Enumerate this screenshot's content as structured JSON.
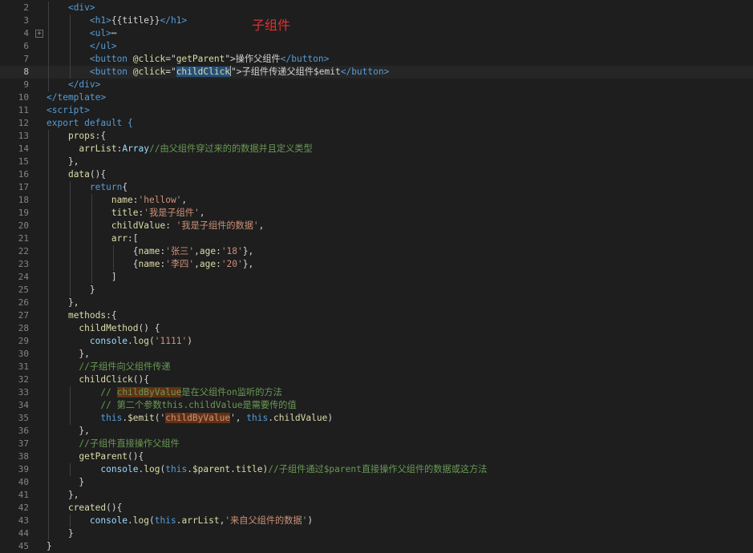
{
  "annotation": "子组件",
  "lines": [
    {
      "n": "2",
      "indent": 1,
      "segs": [
        {
          "t": "<div>",
          "c": "tag"
        }
      ]
    },
    {
      "n": "3",
      "indent": 2,
      "segs": [
        {
          "t": "<h1>",
          "c": "tag"
        },
        {
          "t": "{{title}}",
          "c": "plain"
        },
        {
          "t": "</h1>",
          "c": "tag"
        }
      ]
    },
    {
      "n": "4",
      "indent": 2,
      "fold": "+",
      "segs": [
        {
          "t": "<ul>",
          "c": "tag"
        },
        {
          "t": "⋯",
          "c": "plain"
        }
      ]
    },
    {
      "n": "6",
      "indent": 2,
      "segs": [
        {
          "t": "</ul>",
          "c": "tag"
        }
      ]
    },
    {
      "n": "7",
      "indent": 2,
      "segs": [
        {
          "t": "<button ",
          "c": "tag"
        },
        {
          "t": "@click",
          "c": "fn"
        },
        {
          "t": "=\"",
          "c": "plain"
        },
        {
          "t": "getParent",
          "c": "fn"
        },
        {
          "t": "\">",
          "c": "plain"
        },
        {
          "t": "操作父组件",
          "c": "plain"
        },
        {
          "t": "</button>",
          "c": "tag"
        }
      ]
    },
    {
      "n": "8",
      "indent": 2,
      "active": true,
      "segs": [
        {
          "t": "<button ",
          "c": "tag"
        },
        {
          "t": "@click",
          "c": "fn"
        },
        {
          "t": "=\"",
          "c": "plain"
        },
        {
          "t": "childClick",
          "c": "fn hl"
        },
        {
          "t": "",
          "c": "caret"
        },
        {
          "t": "\">",
          "c": "plain"
        },
        {
          "t": "子组件传递父组件$emit",
          "c": "plain"
        },
        {
          "t": "</button>",
          "c": "tag"
        }
      ]
    },
    {
      "n": "9",
      "indent": 1,
      "segs": [
        {
          "t": "</div>",
          "c": "tag"
        }
      ]
    },
    {
      "n": "10",
      "indent": 0,
      "segs": [
        {
          "t": "</template>",
          "c": "tag"
        }
      ]
    },
    {
      "n": "11",
      "indent": 0,
      "segs": [
        {
          "t": "<script>",
          "c": "tag"
        }
      ]
    },
    {
      "n": "12",
      "indent": 0,
      "segs": [
        {
          "t": "export default {",
          "c": "kw"
        }
      ]
    },
    {
      "n": "13",
      "indent": 1,
      "segs": [
        {
          "t": "props",
          "c": "fn"
        },
        {
          "t": ":{",
          "c": "plain"
        }
      ]
    },
    {
      "n": "14",
      "indent": 1,
      "extra": "  ",
      "segs": [
        {
          "t": "arrList",
          "c": "fn"
        },
        {
          "t": ":",
          "c": "plain"
        },
        {
          "t": "Array",
          "c": "prop"
        },
        {
          "t": "//由父组件穿过来的的数据并且定义类型",
          "c": "cm"
        }
      ]
    },
    {
      "n": "15",
      "indent": 1,
      "segs": [
        {
          "t": "},",
          "c": "plain"
        }
      ]
    },
    {
      "n": "16",
      "indent": 1,
      "segs": [
        {
          "t": "data",
          "c": "fn"
        },
        {
          "t": "(){",
          "c": "plain"
        }
      ]
    },
    {
      "n": "17",
      "indent": 2,
      "segs": [
        {
          "t": "return",
          "c": "kw"
        },
        {
          "t": "{",
          "c": "plain"
        }
      ]
    },
    {
      "n": "18",
      "indent": 3,
      "segs": [
        {
          "t": "name",
          "c": "fn"
        },
        {
          "t": ":",
          "c": "plain"
        },
        {
          "t": "'hellow'",
          "c": "str"
        },
        {
          "t": ",",
          "c": "plain"
        }
      ]
    },
    {
      "n": "19",
      "indent": 3,
      "segs": [
        {
          "t": "title",
          "c": "fn"
        },
        {
          "t": ":",
          "c": "plain"
        },
        {
          "t": "'我是子组件'",
          "c": "str"
        },
        {
          "t": ",",
          "c": "plain"
        }
      ]
    },
    {
      "n": "20",
      "indent": 3,
      "segs": [
        {
          "t": "childValue",
          "c": "fn"
        },
        {
          "t": ": ",
          "c": "plain"
        },
        {
          "t": "'我是子组件的数据'",
          "c": "str"
        },
        {
          "t": ",",
          "c": "plain"
        }
      ]
    },
    {
      "n": "21",
      "indent": 3,
      "segs": [
        {
          "t": "arr",
          "c": "fn"
        },
        {
          "t": ":[",
          "c": "plain"
        }
      ]
    },
    {
      "n": "22",
      "indent": 4,
      "segs": [
        {
          "t": "{",
          "c": "plain"
        },
        {
          "t": "name",
          "c": "fn"
        },
        {
          "t": ":",
          "c": "plain"
        },
        {
          "t": "'张三'",
          "c": "str"
        },
        {
          "t": ",",
          "c": "plain"
        },
        {
          "t": "age",
          "c": "fn"
        },
        {
          "t": ":",
          "c": "plain"
        },
        {
          "t": "'18'",
          "c": "str"
        },
        {
          "t": "},",
          "c": "plain"
        }
      ]
    },
    {
      "n": "23",
      "indent": 4,
      "segs": [
        {
          "t": "{",
          "c": "plain"
        },
        {
          "t": "name",
          "c": "fn"
        },
        {
          "t": ":",
          "c": "plain"
        },
        {
          "t": "'李四'",
          "c": "str"
        },
        {
          "t": ",",
          "c": "plain"
        },
        {
          "t": "age",
          "c": "fn"
        },
        {
          "t": ":",
          "c": "plain"
        },
        {
          "t": "'20'",
          "c": "str"
        },
        {
          "t": "},",
          "c": "plain"
        }
      ]
    },
    {
      "n": "24",
      "indent": 3,
      "segs": [
        {
          "t": "]",
          "c": "plain"
        }
      ]
    },
    {
      "n": "25",
      "indent": 2,
      "segs": [
        {
          "t": "}",
          "c": "plain"
        }
      ]
    },
    {
      "n": "26",
      "indent": 1,
      "segs": [
        {
          "t": "},",
          "c": "plain"
        }
      ]
    },
    {
      "n": "27",
      "indent": 1,
      "segs": [
        {
          "t": "methods",
          "c": "fn"
        },
        {
          "t": ":{",
          "c": "plain"
        }
      ]
    },
    {
      "n": "28",
      "indent": 1,
      "extra": "  ",
      "segs": [
        {
          "t": "childMethod",
          "c": "fn"
        },
        {
          "t": "() {",
          "c": "plain"
        }
      ]
    },
    {
      "n": "29",
      "indent": 1,
      "extra": "    ",
      "segs": [
        {
          "t": "console",
          "c": "prop"
        },
        {
          "t": ".",
          "c": "plain"
        },
        {
          "t": "log",
          "c": "fn"
        },
        {
          "t": "(",
          "c": "plain"
        },
        {
          "t": "'1111'",
          "c": "str"
        },
        {
          "t": ")",
          "c": "plain"
        }
      ]
    },
    {
      "n": "30",
      "indent": 1,
      "extra": "  ",
      "segs": [
        {
          "t": "},",
          "c": "plain"
        }
      ]
    },
    {
      "n": "31",
      "indent": 1,
      "extra": "  ",
      "segs": [
        {
          "t": "//子组件向父组件传递",
          "c": "cm"
        }
      ]
    },
    {
      "n": "32",
      "indent": 1,
      "extra": "  ",
      "segs": [
        {
          "t": "childClick",
          "c": "fn"
        },
        {
          "t": "(){",
          "c": "plain"
        }
      ]
    },
    {
      "n": "33",
      "indent": 2,
      "extra": "  ",
      "segs": [
        {
          "t": "// ",
          "c": "cm"
        },
        {
          "t": "childByValue",
          "c": "cm hl2"
        },
        {
          "t": "是在父组件on监听的方法",
          "c": "cm"
        }
      ]
    },
    {
      "n": "34",
      "indent": 2,
      "extra": "  ",
      "segs": [
        {
          "t": "// 第二个参数this.childValue是需要传的值",
          "c": "cm"
        }
      ]
    },
    {
      "n": "35",
      "indent": 2,
      "extra": "  ",
      "segs": [
        {
          "t": "this",
          "c": "kw"
        },
        {
          "t": ".",
          "c": "plain"
        },
        {
          "t": "$emit",
          "c": "fn"
        },
        {
          "t": "('",
          "c": "plain"
        },
        {
          "t": "childByValue",
          "c": "str hl2"
        },
        {
          "t": "', ",
          "c": "plain"
        },
        {
          "t": "this",
          "c": "kw"
        },
        {
          "t": ".",
          "c": "plain"
        },
        {
          "t": "childValue",
          "c": "fn"
        },
        {
          "t": ")",
          "c": "plain"
        }
      ]
    },
    {
      "n": "36",
      "indent": 1,
      "extra": "  ",
      "segs": [
        {
          "t": "},",
          "c": "plain"
        }
      ]
    },
    {
      "n": "37",
      "indent": 1,
      "extra": "  ",
      "segs": [
        {
          "t": "//子组件直接操作父组件",
          "c": "cm"
        }
      ]
    },
    {
      "n": "38",
      "indent": 1,
      "extra": "  ",
      "segs": [
        {
          "t": "getParent",
          "c": "fn"
        },
        {
          "t": "(){",
          "c": "plain"
        }
      ]
    },
    {
      "n": "39",
      "indent": 2,
      "extra": "  ",
      "segs": [
        {
          "t": "console",
          "c": "prop"
        },
        {
          "t": ".",
          "c": "plain"
        },
        {
          "t": "log",
          "c": "fn"
        },
        {
          "t": "(",
          "c": "plain"
        },
        {
          "t": "this",
          "c": "kw"
        },
        {
          "t": ".",
          "c": "plain"
        },
        {
          "t": "$parent",
          "c": "fn"
        },
        {
          "t": ".",
          "c": "plain"
        },
        {
          "t": "title",
          "c": "fn"
        },
        {
          "t": ")",
          "c": "plain"
        },
        {
          "t": "//子组件通过$parent直接操作父组件的数据或这方法",
          "c": "cm"
        }
      ]
    },
    {
      "n": "40",
      "indent": 1,
      "extra": "  ",
      "segs": [
        {
          "t": "}",
          "c": "plain"
        }
      ]
    },
    {
      "n": "41",
      "indent": 1,
      "segs": [
        {
          "t": "},",
          "c": "plain"
        }
      ]
    },
    {
      "n": "42",
      "indent": 1,
      "segs": [
        {
          "t": "created",
          "c": "fn"
        },
        {
          "t": "(){",
          "c": "plain"
        }
      ]
    },
    {
      "n": "43",
      "indent": 2,
      "segs": [
        {
          "t": "console",
          "c": "prop"
        },
        {
          "t": ".",
          "c": "plain"
        },
        {
          "t": "log",
          "c": "fn"
        },
        {
          "t": "(",
          "c": "plain"
        },
        {
          "t": "this",
          "c": "kw"
        },
        {
          "t": ".",
          "c": "plain"
        },
        {
          "t": "arrList",
          "c": "fn"
        },
        {
          "t": ",",
          "c": "plain"
        },
        {
          "t": "'来自父组件的数据'",
          "c": "str"
        },
        {
          "t": ")",
          "c": "plain"
        }
      ]
    },
    {
      "n": "44",
      "indent": 1,
      "segs": [
        {
          "t": "}",
          "c": "plain"
        }
      ]
    },
    {
      "n": "45",
      "indent": 0,
      "segs": [
        {
          "t": "}",
          "c": "plain"
        }
      ]
    }
  ]
}
